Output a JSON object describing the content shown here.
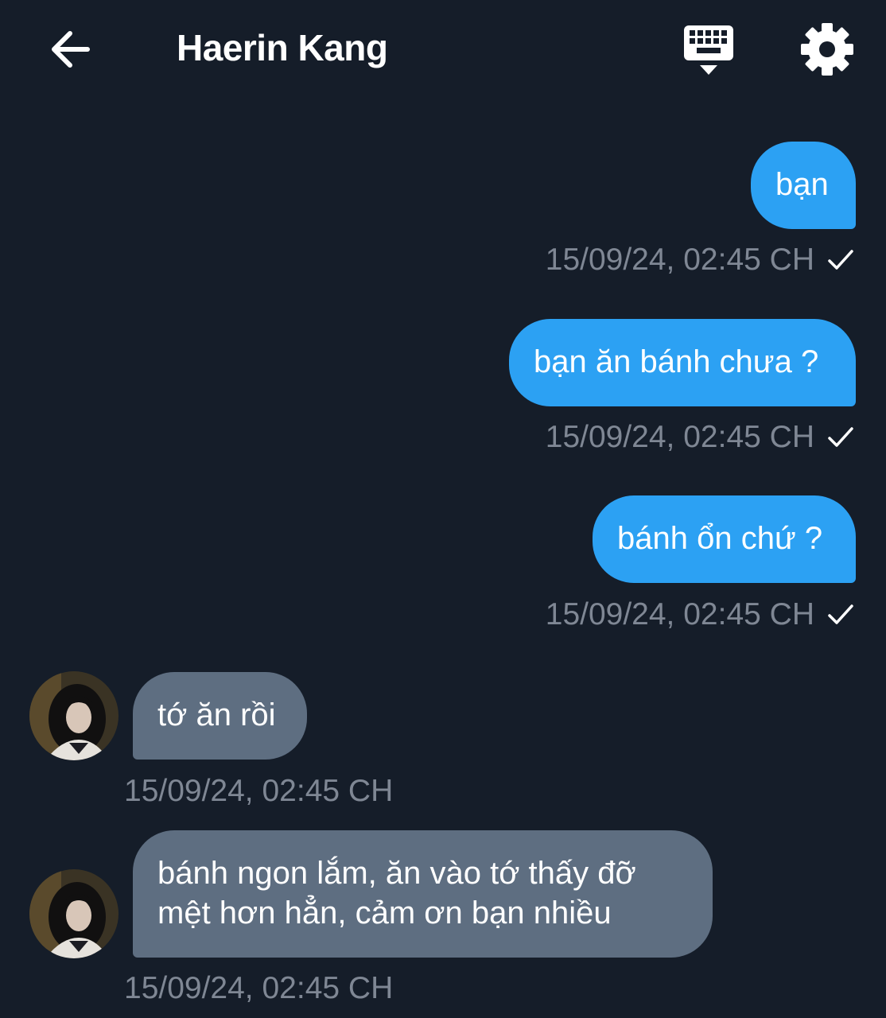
{
  "header": {
    "title": "Haerin Kang",
    "back_icon": "arrow-left-icon",
    "keyboard_icon": "keyboard-icon",
    "settings_icon": "gear-icon"
  },
  "colors": {
    "background": "#151d29",
    "outgoing_bubble": "#2ca1f3",
    "incoming_bubble": "#5e6e81",
    "timestamp": "#7f8794"
  },
  "messages": [
    {
      "direction": "outgoing",
      "text": "bạn",
      "time": "15/09/24, 02:45 CH",
      "status_icon": "check-icon"
    },
    {
      "direction": "outgoing",
      "text": "bạn ăn bánh chưa ?",
      "time": "15/09/24, 02:45 CH",
      "status_icon": "check-icon"
    },
    {
      "direction": "outgoing",
      "text": "bánh ổn chứ ?",
      "time": "15/09/24, 02:45 CH",
      "status_icon": "check-icon"
    },
    {
      "direction": "incoming",
      "text": "tớ ăn rồi",
      "time": "15/09/24, 02:45 CH"
    },
    {
      "direction": "incoming",
      "lines": [
        "bánh ngon lắm, ăn vào tớ thấy đỡ",
        "mệt hơn hẳn, cảm ơn bạn nhiều"
      ],
      "time": "15/09/24, 02:45 CH"
    }
  ]
}
